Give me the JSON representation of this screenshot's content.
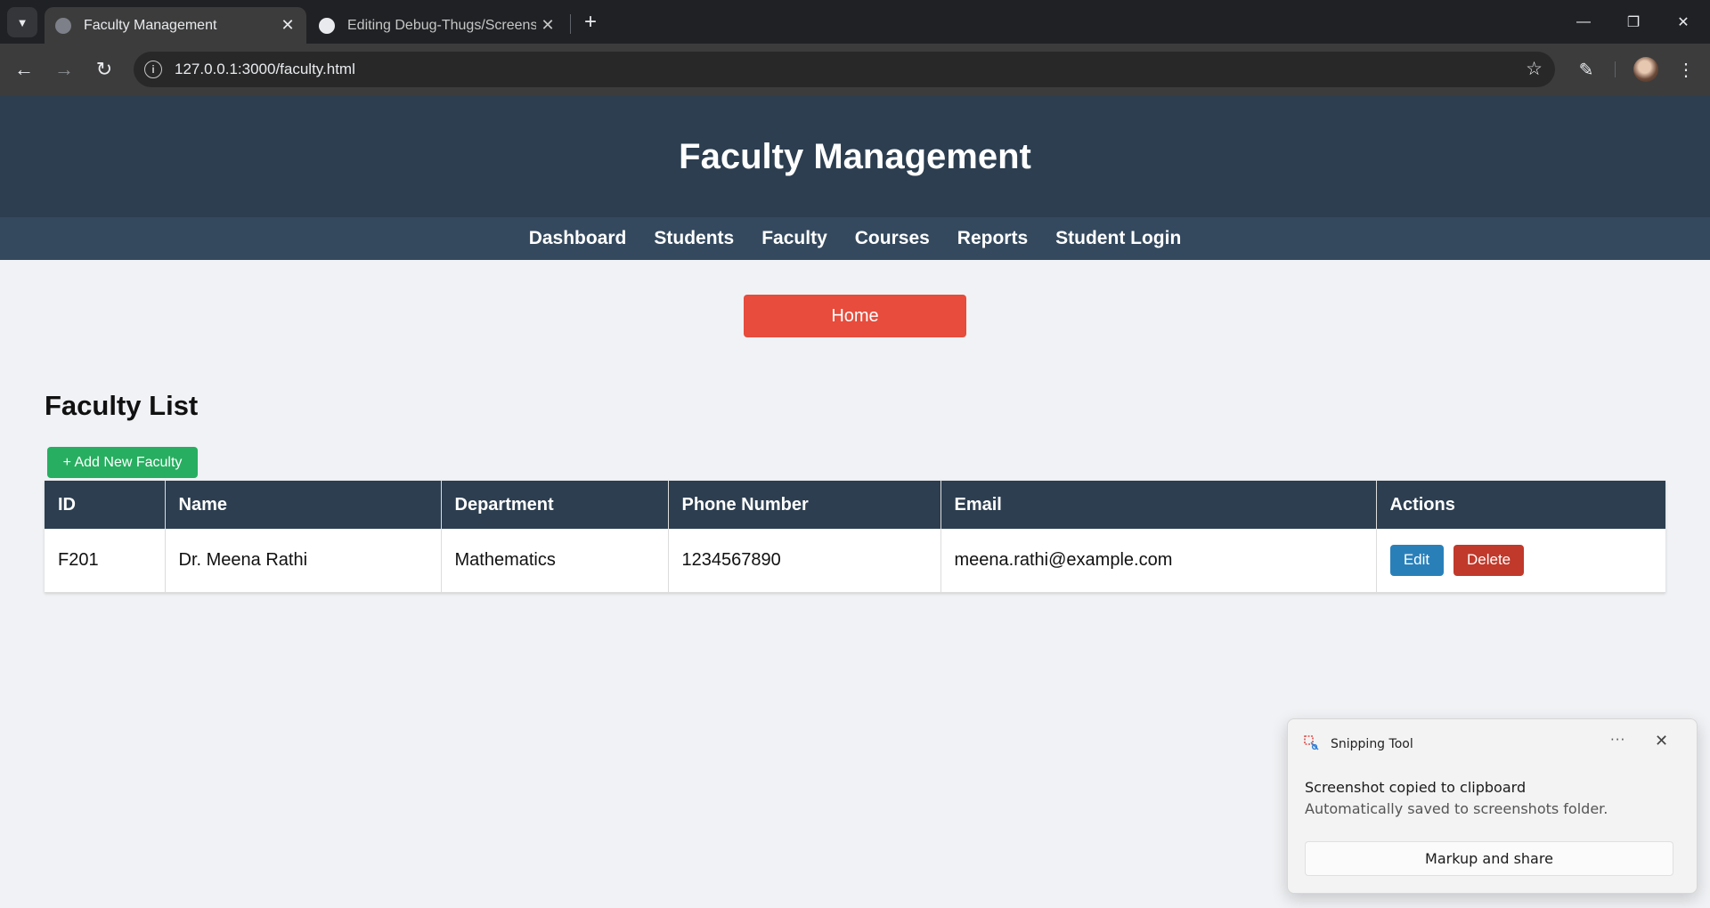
{
  "browser": {
    "tabs": [
      {
        "title": "Faculty Management",
        "favicon": "globe-icon",
        "active": true
      },
      {
        "title": "Editing Debug-Thugs/Screensho",
        "favicon": "github-icon",
        "active": false
      }
    ],
    "url": "127.0.0.1:3000/faculty.html"
  },
  "site": {
    "title": "Faculty Management",
    "nav": [
      "Dashboard",
      "Students",
      "Faculty",
      "Courses",
      "Reports",
      "Student Login"
    ],
    "home_label": "Home"
  },
  "faculty": {
    "section_title": "Faculty List",
    "add_label": "+ Add New Faculty",
    "columns": [
      "ID",
      "Name",
      "Department",
      "Phone Number",
      "Email",
      "Actions"
    ],
    "rows": [
      {
        "id": "F201",
        "name": "Dr. Meena Rathi",
        "department": "Mathematics",
        "phone": "1234567890",
        "email": "meena.rathi@example.com",
        "edit_label": "Edit",
        "delete_label": "Delete"
      }
    ]
  },
  "toast": {
    "app": "Snipping Tool",
    "title": "Screenshot copied to clipboard",
    "body": "Automatically saved to screenshots folder.",
    "action": "Markup and share"
  },
  "colors": {
    "header": "#2c3e50",
    "nav": "#34495e",
    "home_button": "#e74c3c",
    "add_button": "#27ae60",
    "edit_button": "#2980b9",
    "delete_button": "#c0392b"
  }
}
